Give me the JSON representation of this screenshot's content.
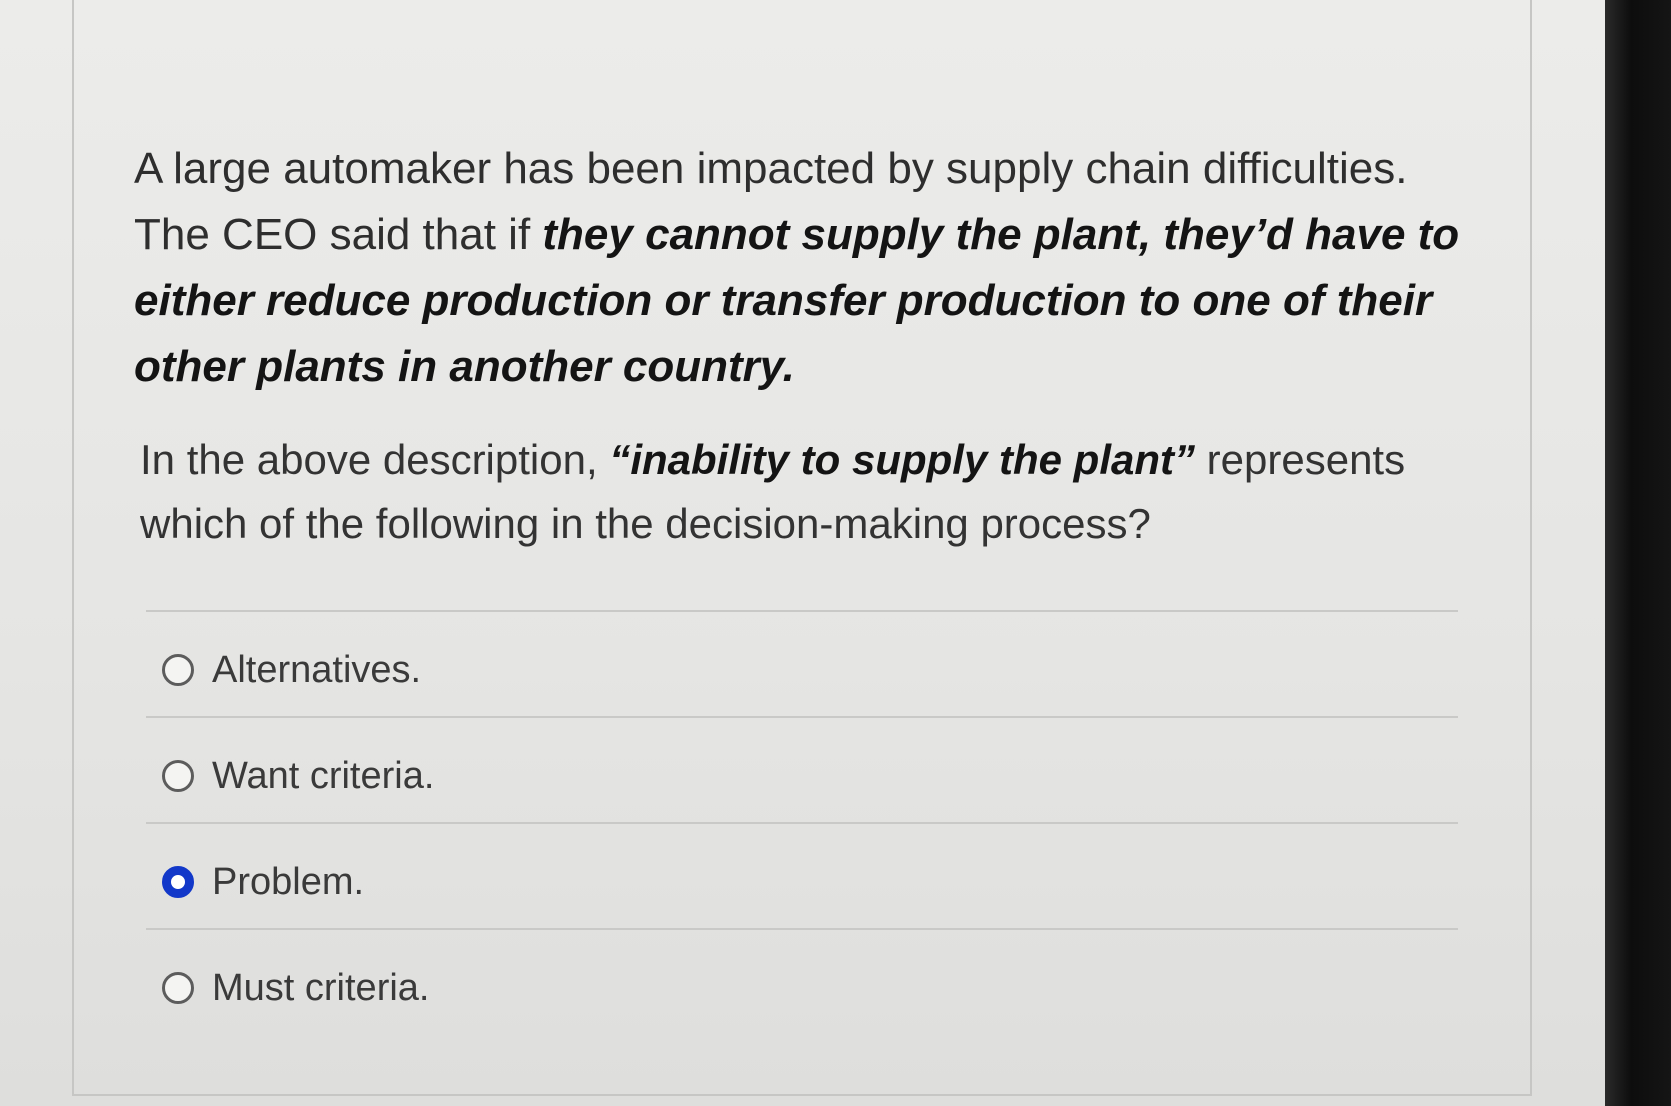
{
  "question": {
    "part1": "A large automaker has been impacted by supply chain difficulties. The CEO said that if ",
    "emphasis": "they cannot supply the plant, they’d have to either reduce production or transfer production to one of their other plants in another country."
  },
  "prompt": {
    "part1": "In the above description, ",
    "emphasis": "“inability to supply the plant”",
    "part2": " represents which of the following in the decision-making process?"
  },
  "options": [
    {
      "label": "Alternatives.",
      "selected": false
    },
    {
      "label": "Want criteria.",
      "selected": false
    },
    {
      "label": "Problem.",
      "selected": true
    },
    {
      "label": "Must criteria.",
      "selected": false
    }
  ],
  "colors": {
    "selected_radio": "#1238c9"
  }
}
